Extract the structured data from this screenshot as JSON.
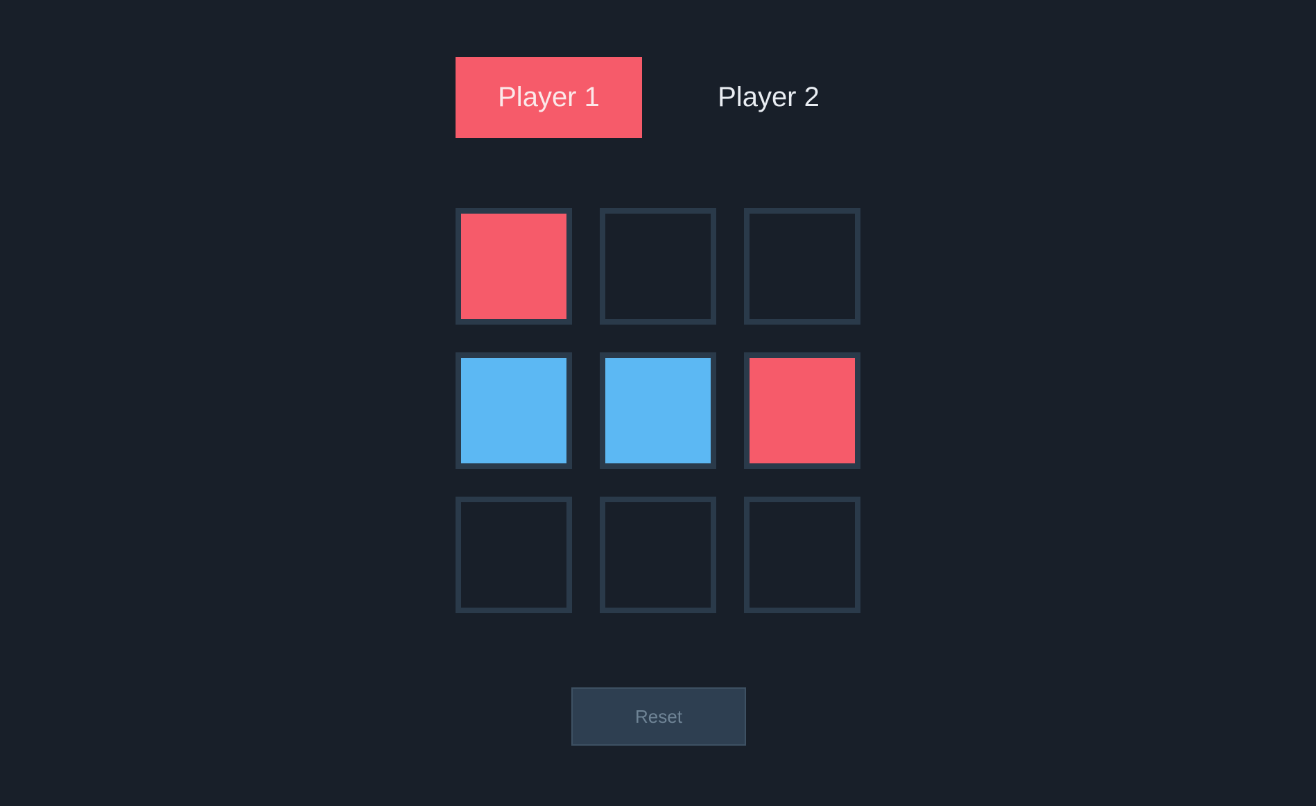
{
  "players": [
    {
      "label": "Player 1",
      "active": true
    },
    {
      "label": "Player 2",
      "active": false
    }
  ],
  "colors": {
    "background": "#181f29",
    "player1": "#f65b6a",
    "player2": "#5cb8f3",
    "cell_border": "#2a3a4a",
    "reset_bg": "#2e3f51",
    "reset_text": "#6f8496"
  },
  "board": {
    "cells": [
      "player1",
      "empty",
      "empty",
      "player2",
      "player2",
      "player1",
      "empty",
      "empty",
      "empty"
    ]
  },
  "controls": {
    "reset_label": "Reset"
  }
}
